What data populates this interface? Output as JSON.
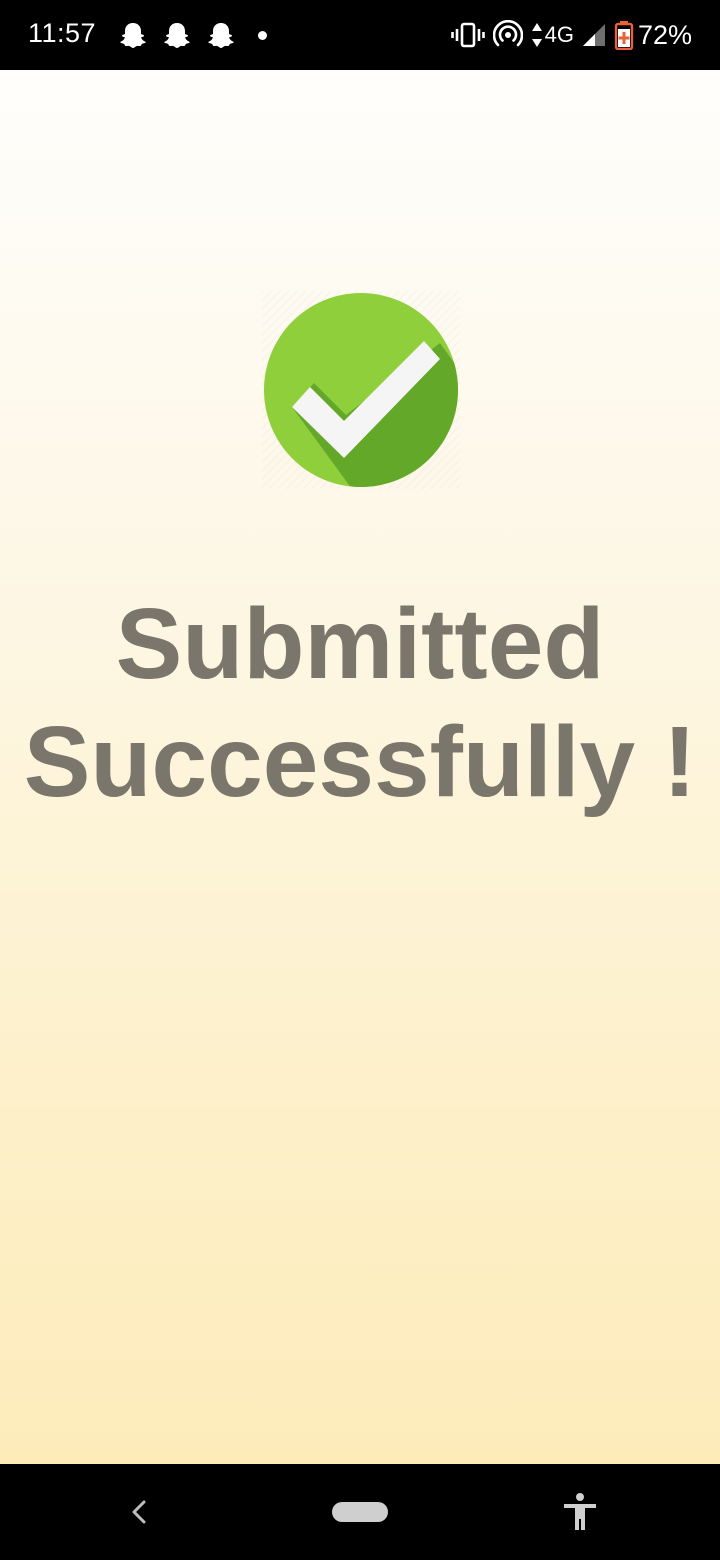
{
  "status_bar": {
    "time": "11:57",
    "notification_icons": [
      "snapchat-icon",
      "snapchat-icon",
      "snapchat-icon"
    ],
    "network": "4G",
    "battery": "72%"
  },
  "main": {
    "success_icon": "check-circle-icon",
    "headline_line1": "Submitted",
    "headline_line2": "Successfully !"
  },
  "colors": {
    "headline": "#7a766b",
    "check_circle": "#8fcf3c",
    "check_shadow": "#64a82a",
    "background_top": "#fffefc",
    "background_bottom": "#fdebba"
  },
  "nav_bar": {
    "back_icon": "back-chevron-icon",
    "home_icon": "home-pill-icon",
    "accessibility_icon": "accessibility-icon"
  }
}
